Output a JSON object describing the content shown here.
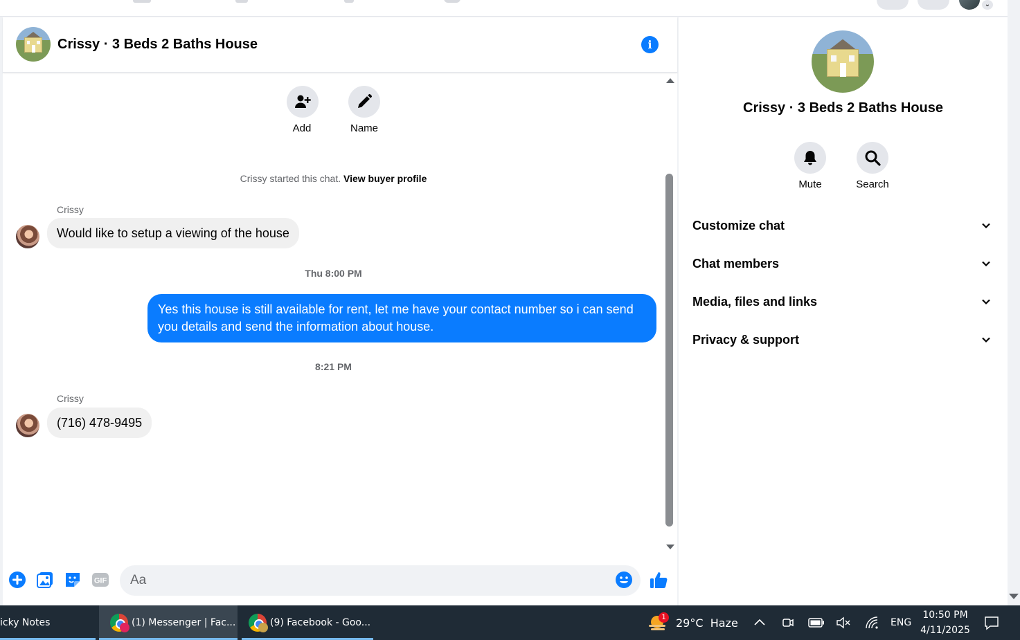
{
  "chat": {
    "title": "Crissy · 3 Beds 2 Baths House",
    "actions": {
      "add_label": "Add",
      "name_label": "Name"
    },
    "system_text": "Crissy started this chat.",
    "system_link": "View buyer profile",
    "messages": [
      {
        "sender": "Crissy",
        "text": "Would like to setup a viewing of the house"
      },
      {
        "timestamp": "Thu 8:00 PM"
      },
      {
        "text": "Yes this house is still available for rent, let me have your contact number so i can send you details and send the information about house."
      },
      {
        "timestamp": "8:21 PM"
      },
      {
        "sender": "Crissy",
        "text": "(716) 478-9495"
      }
    ],
    "composer_placeholder": "Aa"
  },
  "side": {
    "title": "Crissy · 3 Beds 2 Baths House",
    "mute_label": "Mute",
    "search_label": "Search",
    "sections": [
      "Customize chat",
      "Chat members",
      "Media, files and links",
      "Privacy & support"
    ]
  },
  "taskbar": {
    "items": [
      "icky Notes",
      "(1) Messenger | Fac...",
      "(9) Facebook - Goo..."
    ],
    "weather_badge": "1",
    "weather": "29°C  Haze",
    "language": "ENG",
    "time": "10:50 PM",
    "date": "4/11/2025"
  },
  "colors": {
    "messenger_blue": "#0a7cff",
    "bubble_grey": "#f0f0f0",
    "taskbar": "#1f2b36"
  }
}
